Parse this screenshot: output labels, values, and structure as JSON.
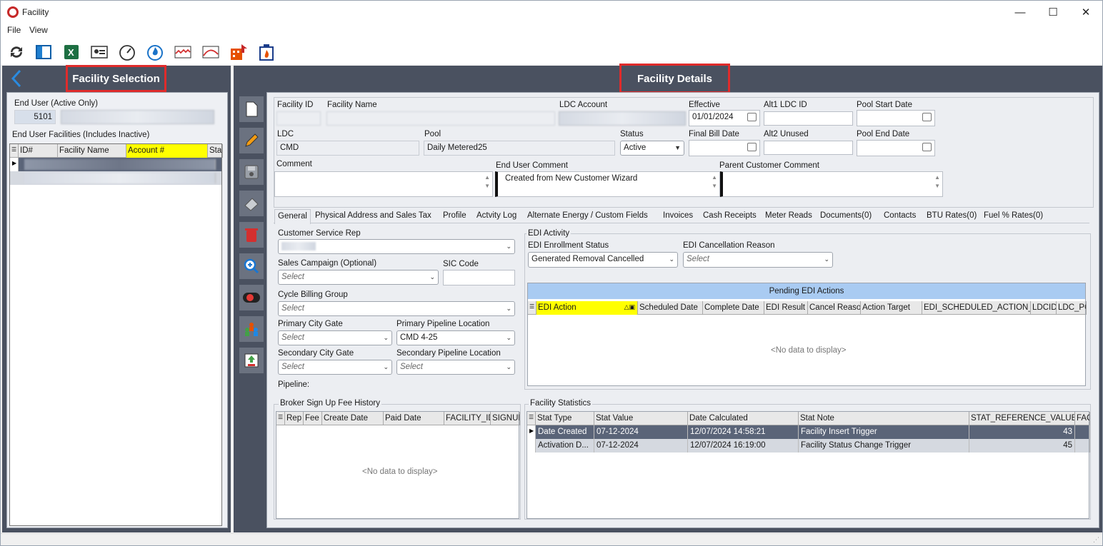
{
  "window": {
    "title": "Facility"
  },
  "menu": {
    "file": "File",
    "view": "View"
  },
  "toolbar_icons": [
    "refresh-icon",
    "panel-toggle-icon",
    "excel-icon",
    "contact-card-icon",
    "gauge-icon",
    "gas-flame-icon",
    "chart-red-wave-icon",
    "chart-red-curve-icon",
    "building-arrow-icon",
    "building-flame-icon"
  ],
  "left": {
    "header": "Facility Selection",
    "end_user_label": "End User (Active Only)",
    "end_user_id": "5101",
    "facilities_label": "End User Facilities (Includes Inactive)",
    "columns": [
      "ID#",
      "Facility Name",
      "Account #",
      "Sta"
    ]
  },
  "right": {
    "header": "Facility Details",
    "facility_id_label": "Facility ID",
    "facility_name_label": "Facility Name",
    "ldc_account_label": "LDC Account",
    "effective_label": "Effective",
    "effective_value": "01/01/2024",
    "alt1_label": "Alt1  LDC ID",
    "pool_start_label": "Pool Start Date",
    "ldc_label": "LDC",
    "ldc_value": "CMD",
    "pool_label": "Pool",
    "pool_value": "Daily Metered25",
    "status_label": "Status",
    "status_value": "Active",
    "final_bill_label": "Final Bill Date",
    "alt2_label": "Alt2  Unused",
    "pool_end_label": "Pool End Date",
    "comment_label": "Comment",
    "end_user_comment_label": "End User Comment",
    "end_user_comment_value": "Created from New Customer Wizard",
    "parent_comment_label": "Parent Customer Comment"
  },
  "tabs": [
    "General",
    "Physical Address and Sales Tax",
    "Profile",
    "Actvity Log",
    "Alternate Energy / Custom Fields",
    "Invoices",
    "Cash Receipts",
    "Meter Reads",
    "Documents(0)",
    "Contacts",
    "BTU Rates(0)",
    "Fuel % Rates(0)"
  ],
  "general": {
    "csr_label": "Customer Service Rep",
    "sales_campaign_label": "Sales Campaign (Optional)",
    "sic_label": "SIC Code",
    "cycle_label": "Cycle Billing Group",
    "primary_city_gate_label": "Primary City Gate",
    "primary_pipeline_label": "Primary Pipeline Location",
    "primary_pipeline_value": "CMD 4-25",
    "secondary_city_gate_label": "Secondary City Gate",
    "secondary_pipeline_label": "Secondary Pipeline Location",
    "pipeline_label": "Pipeline:",
    "select_placeholder": "Select"
  },
  "edi": {
    "section_label": "EDI Activity",
    "enrollment_label": "EDI Enrollment Status",
    "enrollment_value": "Generated Removal Cancelled",
    "cancellation_label": "EDI Cancellation Reason",
    "pending_title": "Pending EDI Actions",
    "columns": [
      "EDI Action",
      "Scheduled Date",
      "Complete Date",
      "EDI Result",
      "Cancel Reaso",
      "Action Target",
      "EDI_SCHEDULED_ACTION_ID",
      "LDCID",
      "LDC_PO"
    ],
    "no_data": "<No data to display>"
  },
  "broker": {
    "title": "Broker Sign Up Fee History",
    "columns": [
      "Rep",
      "Fee",
      "Create Date",
      "Paid Date",
      "FACILITY_ID",
      "SIGNUP"
    ],
    "no_data": "<No data to display>"
  },
  "stats": {
    "title": "Facility Statistics",
    "columns": [
      "Stat Type",
      "Stat Value",
      "Date Calculated",
      "Stat Note",
      "STAT_REFERENCE_VALUE_ID",
      "FAC"
    ],
    "rows": [
      [
        "Date Created",
        "07-12-2024",
        "12/07/2024 14:58:21",
        "Facility Insert Trigger",
        "43",
        ""
      ],
      [
        "Activation D...",
        "07-12-2024",
        "12/07/2024 16:19:00",
        "Facility Status Change Trigger",
        "45",
        ""
      ]
    ]
  },
  "side_buttons": [
    "new-document-icon",
    "edit-pencil-icon",
    "save-disk-icon",
    "eraser-icon",
    "delete-trash-icon",
    "zoom-in-icon",
    "toggle-record-icon",
    "people-group-icon",
    "import-export-icon"
  ]
}
